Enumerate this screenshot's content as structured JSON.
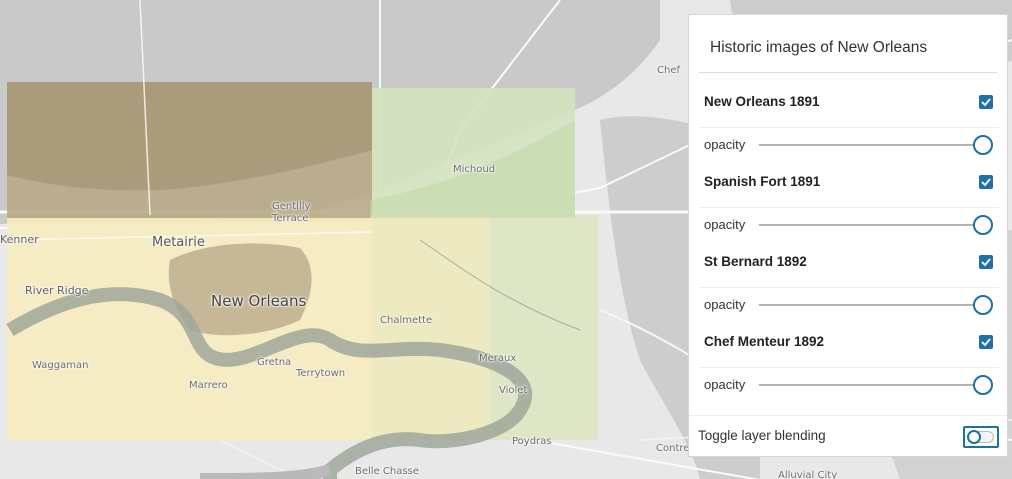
{
  "panel": {
    "title": "Historic images of New Orleans",
    "layers": [
      {
        "title": "New Orleans 1891",
        "checked": true,
        "opacity_label": "opacity",
        "opacity": 1.0
      },
      {
        "title": "Spanish Fort 1891",
        "checked": true,
        "opacity_label": "opacity",
        "opacity": 1.0
      },
      {
        "title": "St Bernard 1892",
        "checked": true,
        "opacity_label": "opacity",
        "opacity": 1.0
      },
      {
        "title": "Chef Menteur 1892",
        "checked": true,
        "opacity_label": "opacity",
        "opacity": 1.0
      }
    ],
    "blend": {
      "label": "Toggle layer blending",
      "enabled": false
    }
  },
  "map": {
    "places": {
      "kenner": "Kenner",
      "metairie": "Metairie",
      "river_ridge": "River Ridge",
      "new_orleans": "New Orleans",
      "gentilly_1": "Gentilly",
      "gentilly_2": "Terrace",
      "michoud": "Michoud",
      "chalmette": "Chalmette",
      "waggaman": "Waggaman",
      "gretna": "Gretna",
      "marrero": "Marrero",
      "terrytown": "Terrytown",
      "meraux": "Meraux",
      "violet": "Violet",
      "poydras": "Poydras",
      "belle_chasse": "Belle Chasse",
      "chef": "Chef",
      "contre": "Contre",
      "alluvial": "Alluvial City"
    },
    "colors": {
      "land": "#e8e8e8",
      "water": "#c6c6c6",
      "overlay_sepia": "#a89a78",
      "overlay_cream": "#f7eec6",
      "overlay_green": "#d5e3bf",
      "accent": "#1673a5"
    }
  }
}
